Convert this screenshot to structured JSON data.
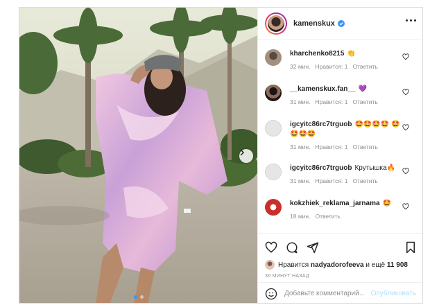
{
  "post": {
    "username": "kamenskux",
    "verified": true,
    "comments": [
      {
        "user": "kharchenko8215",
        "text": "👏",
        "time": "32 мин.",
        "likes": "Нравится: 1",
        "reply": "Ответить",
        "avatar_color": "#8a7a70"
      },
      {
        "user": "__kamenskux.fan__",
        "text": "💜",
        "time": "31 мин.",
        "likes": "Нравится: 1",
        "reply": "Ответить",
        "avatar_color": "#2b1f1c"
      },
      {
        "user": "igcyitc86rc7trguob",
        "text": "🤩🤩🤩🤩 🤩🤩🤩🤩",
        "time": "31 мин.",
        "likes": "Нравится: 1",
        "reply": "Ответить",
        "avatar_color": "#e6e6e6"
      },
      {
        "user": "igcyitc86rc7trguob",
        "text": "Крутышка🔥",
        "time": "31 мин.",
        "likes": "Нравится: 1",
        "reply": "Ответить",
        "avatar_color": "#e6e6e6"
      },
      {
        "user": "kokzhiek_reklama_jarnama",
        "text": "🤩",
        "time": "18 мин.",
        "likes": "",
        "reply": "Ответить",
        "avatar_color": "#c8302c"
      }
    ],
    "likes": {
      "prefix": "Нравится",
      "liker": "nadyadorofeeva",
      "middle": "и ещё",
      "count": "11 908"
    },
    "time_ago": "36 МИНУТ НАЗАД",
    "add_comment_placeholder": "Добавьте комментарий...",
    "publish_label": "Опубликовать",
    "colors": {
      "accent": "#3897f0",
      "publish_disabled": "#b2dffc",
      "muted": "#8e8e8e"
    }
  },
  "icons": [
    "heart-icon",
    "comment-icon",
    "share-icon",
    "bookmark-icon",
    "smile-icon",
    "more-icon",
    "verified-icon",
    "chevron-right-icon"
  ]
}
